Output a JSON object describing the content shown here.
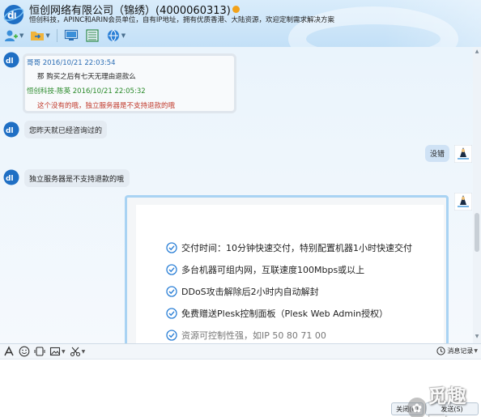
{
  "window": {
    "title": "恒创网络有限公司（锦绣）(4000060313)",
    "subtitle": "恒创科技，APINC和ARIN会员单位，自有IP地址，拥有优质香港、大陆资源，欢迎定制需求解决方案"
  },
  "toolbar": {
    "items": [
      {
        "icon": "add-contact-icon"
      },
      {
        "icon": "transfer-file-icon"
      },
      {
        "icon": "remote-desktop-icon"
      },
      {
        "icon": "app-panel-icon"
      },
      {
        "icon": "more-apps-icon"
      }
    ]
  },
  "colors": {
    "header_bg": "#c9e4f8",
    "chat_bg": "#eef5fc",
    "bubble_left": "#e4ebf2",
    "bubble_right": "#cfe2f5",
    "card_border": "#a9d3f3",
    "check_color": "#2a7fd6",
    "quote_sender_2": "#2a8a2a",
    "quote_reply_text": "#c0392b"
  },
  "messages": {
    "quote": {
      "sender1": "哥哥 2016/10/21 22:03:54",
      "text1": "那 购买之后有七天无理由退款么",
      "sender2": "恒创科技-陈英 2016/10/21 22:05:32",
      "text2": "这个没有的哦，独立服务器是不支持退款的哦"
    },
    "msg2": "您昨天就已经咨询过的",
    "msg_right": "没错",
    "msg3": "独立服务器是不支持退款的哦",
    "card_features": [
      "交付时间：10分钟快速交付，特别配置机器1小时快速交付",
      "多台机器可组内网，互联速度100Mbps或以上",
      "DDoS攻击解除后2小时内自动解封",
      "免费赠送Plesk控制面板（Plesk Web Admin授权）",
      "资源可控制性强，如IP 50 80 71 00"
    ]
  },
  "input_toolbar": {
    "font_icon": "font-icon",
    "emoji_icon": "emoji-icon",
    "shake_icon": "shake-icon",
    "screenshot_icon": "image-icon",
    "cut_icon": "scissors-icon",
    "history_label": "消息记录"
  },
  "input": {
    "value": "",
    "close_label": "关闭(C)",
    "send_label": "发送(S)"
  },
  "watermark": {
    "text": "觅趣网"
  }
}
